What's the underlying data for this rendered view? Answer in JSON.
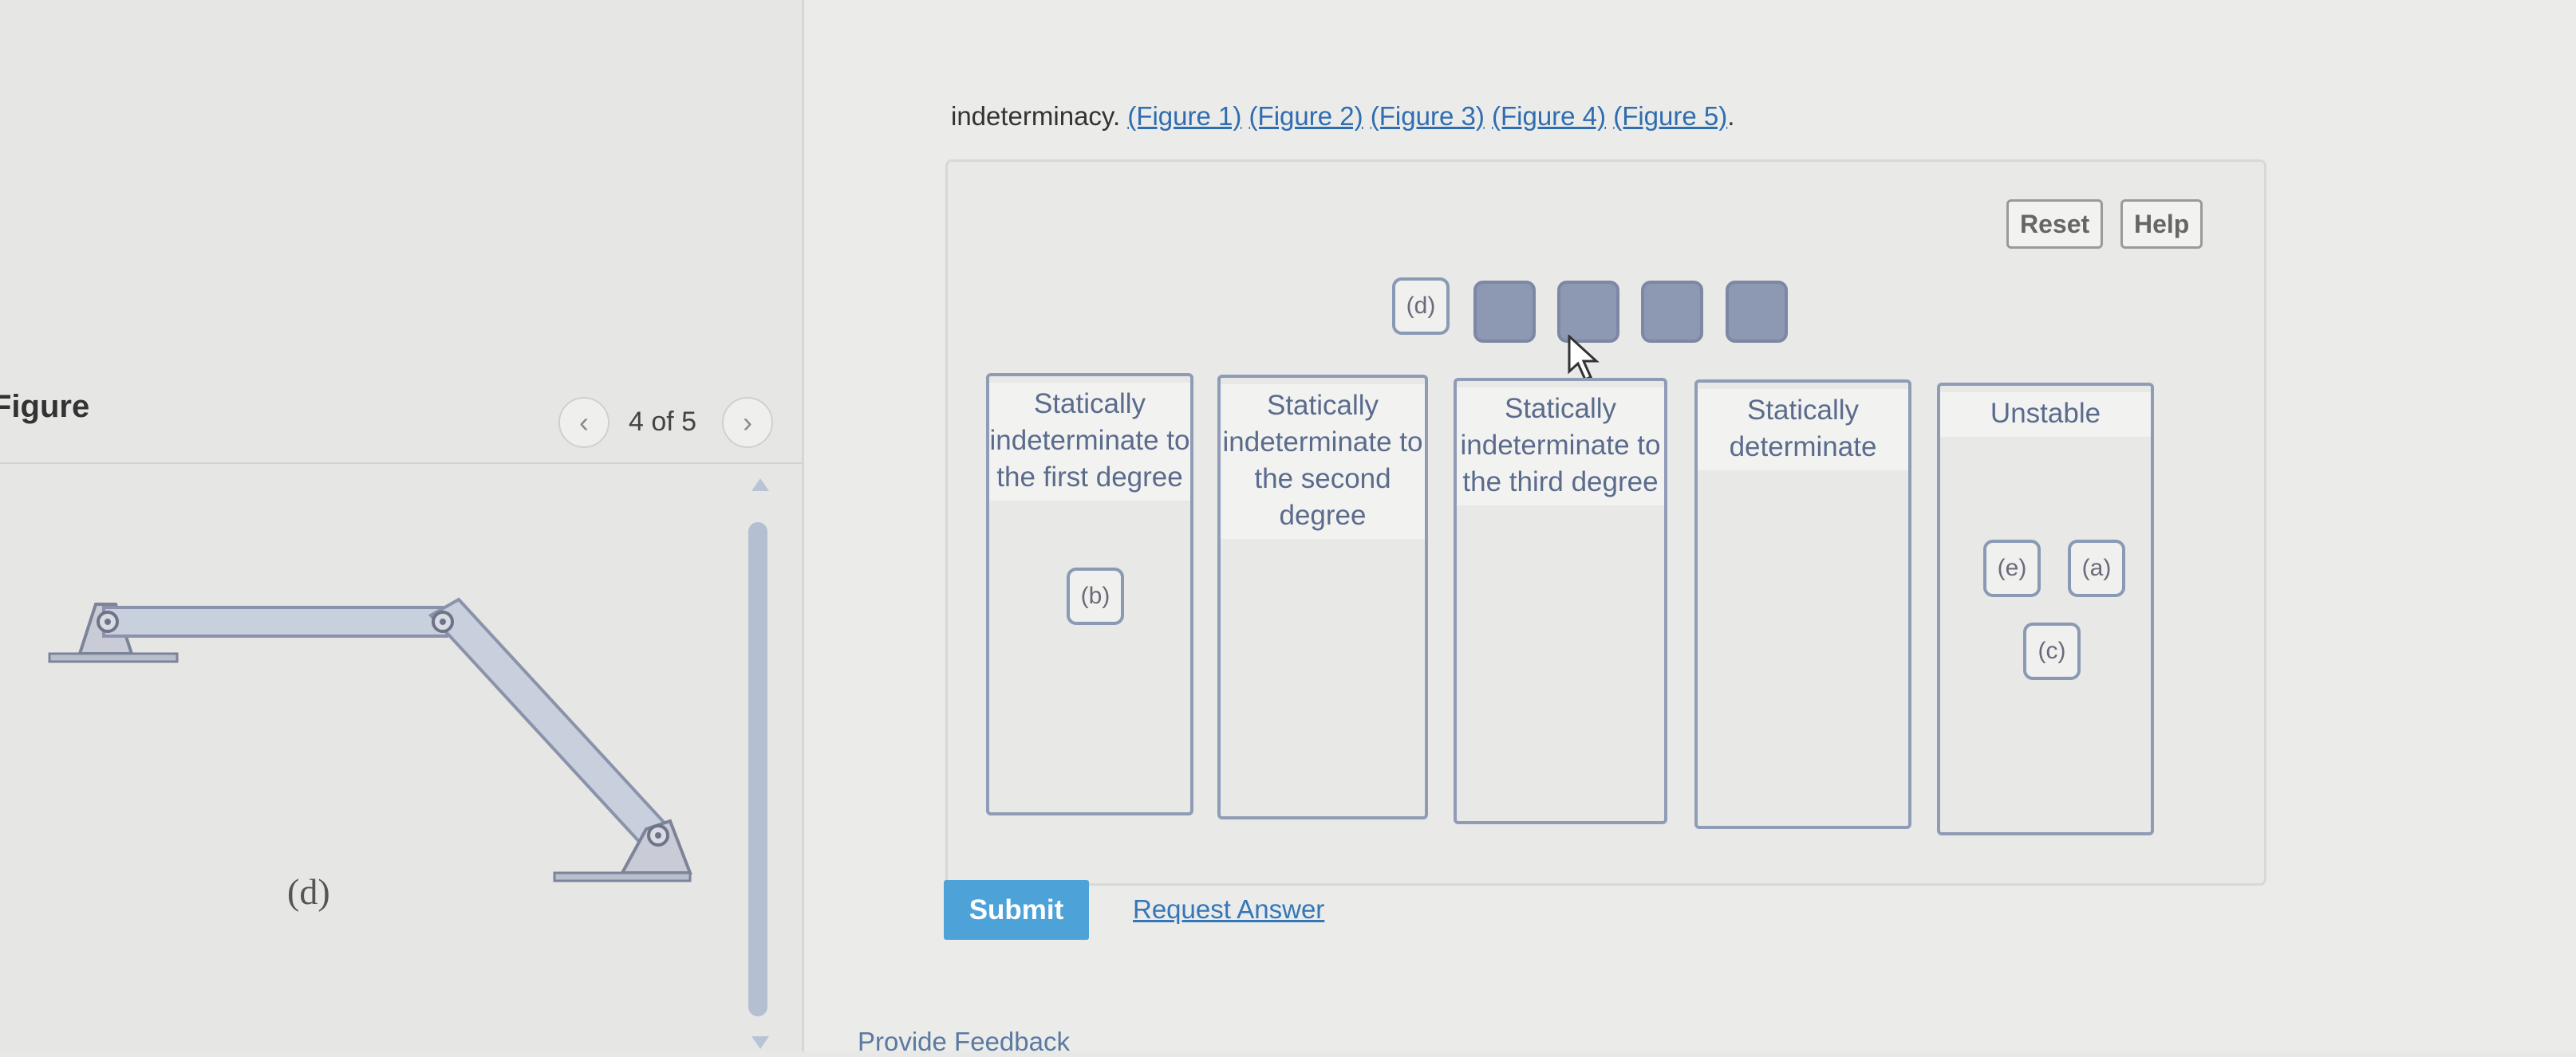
{
  "figure_panel": {
    "title": "Figure",
    "pager_text": "4 of 5",
    "prev_icon": "chevron-left-icon",
    "next_icon": "chevron-right-icon",
    "figure_label": "(d)"
  },
  "prompt": {
    "lead": "indeterminacy. ",
    "links": [
      "(Figure 1)",
      "(Figure 2)",
      "(Figure 3)",
      "(Figure 4)",
      "(Figure 5)"
    ],
    "tail": "."
  },
  "toolbar": {
    "reset_label": "Reset",
    "help_label": "Help"
  },
  "drag_source": {
    "chip_label": "(d)"
  },
  "bins": [
    {
      "label": "Statically indeterminate to the first degree",
      "items": [
        "(b)"
      ]
    },
    {
      "label": "Statically indeterminate to the second degree",
      "items": []
    },
    {
      "label": "Statically indeterminate to the third degree",
      "items": []
    },
    {
      "label": "Statically determinate",
      "items": []
    },
    {
      "label": "Unstable",
      "items": [
        "(e)",
        "(a)",
        "(c)"
      ]
    }
  ],
  "actions": {
    "submit_label": "Submit",
    "request_label": "Request Answer",
    "feedback_label": "Provide Feedback"
  },
  "colors": {
    "submit_bg": "#4da3d8",
    "link": "#2f6db0",
    "chip_border": "#8a9ab4",
    "slot_fill": "#8d98b2"
  }
}
